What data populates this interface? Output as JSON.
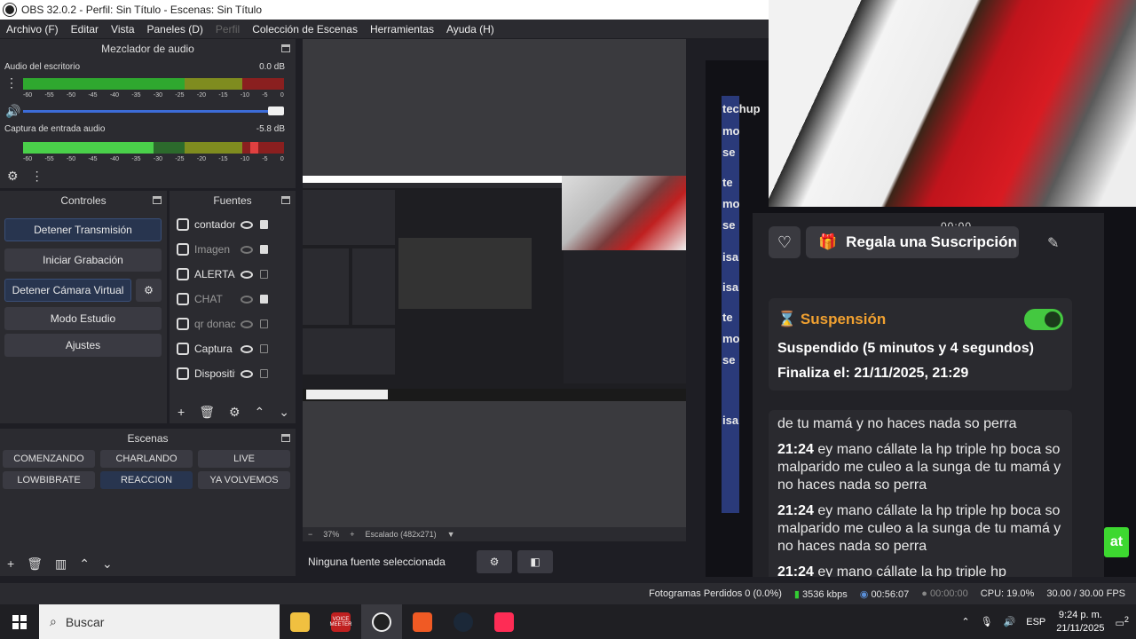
{
  "window": {
    "title": "OBS 32.0.2 - Perfil: Sin Título - Escenas: Sin Título"
  },
  "menu": [
    "Archivo (F)",
    "Editar",
    "Vista",
    "Paneles (D)",
    "Perfil",
    "Colección de Escenas",
    "Herramientas",
    "Ayuda (H)"
  ],
  "mixer": {
    "title": "Mezclador de audio",
    "ch1": {
      "name": "Audio del escritorio",
      "db": "0.0 dB"
    },
    "ch2": {
      "name": "Captura de entrada audio",
      "db": "-5.8 dB"
    },
    "ticks": [
      "-60",
      "-55",
      "-50",
      "-45",
      "-40",
      "-35",
      "-30",
      "-25",
      "-20",
      "-15",
      "-10",
      "-5",
      "0"
    ]
  },
  "controls": {
    "title": "Controles",
    "stop_stream": "Detener Transmisión",
    "start_record": "Iniciar Grabación",
    "stop_vcam": "Detener Cámara Virtual",
    "studio": "Modo Estudio",
    "settings": "Ajustes"
  },
  "sources": {
    "title": "Fuentes",
    "items": [
      "contador",
      "Imagen",
      "ALERTAS",
      "CHAT",
      "qr donac",
      "Captura d",
      "Dispositiv"
    ]
  },
  "scenes": {
    "title": "Escenas",
    "items": [
      "COMENZANDO",
      "CHARLANDO",
      "LIVE",
      "LOWBIBRATE",
      "REACCION",
      "YA VOLVEMOS"
    ]
  },
  "preview": {
    "zoom": "37%",
    "scaled": "Escalado (482x271)"
  },
  "selection": {
    "none": "Ninguna fuente seleccionada"
  },
  "chatside": {
    "tags": [
      "techup",
      "mo",
      "se",
      "te",
      "mo",
      "se",
      "isa",
      "isa",
      "te",
      "mo",
      "se",
      "isa"
    ]
  },
  "overlay": {
    "timer": "00:00",
    "gift": "Regala una Suscripción",
    "suspension": {
      "title": "Suspensión",
      "line1": "Suspendido (5 minutos y 4 segundos)",
      "line2": "Finaliza el: 21/11/2025, 21:29"
    },
    "messages": {
      "first": "de tu mamá y no haces nada so perra",
      "time": "21:24",
      "text": "ey mano cállate la hp triple hp boca so malparido me culeo a la sunga de tu mamá y no haces nada so perra",
      "last": "ey mano cállate la hp triple hp"
    },
    "green_btn": "at"
  },
  "status": {
    "dropped": "Fotogramas Perdidos 0 (0.0%)",
    "kbps": "3536 kbps",
    "stream_time": "00:56:07",
    "rec_time": "00:00:00",
    "cpu": "CPU: 19.0%",
    "fps": "30.00 / 30.00 FPS"
  },
  "taskbar": {
    "search": "Buscar",
    "lang": "ESP",
    "time": "9:24 p. m.",
    "date": "21/11/2025",
    "notif": "2",
    "voicemeeter": "VOICE MEETER"
  }
}
